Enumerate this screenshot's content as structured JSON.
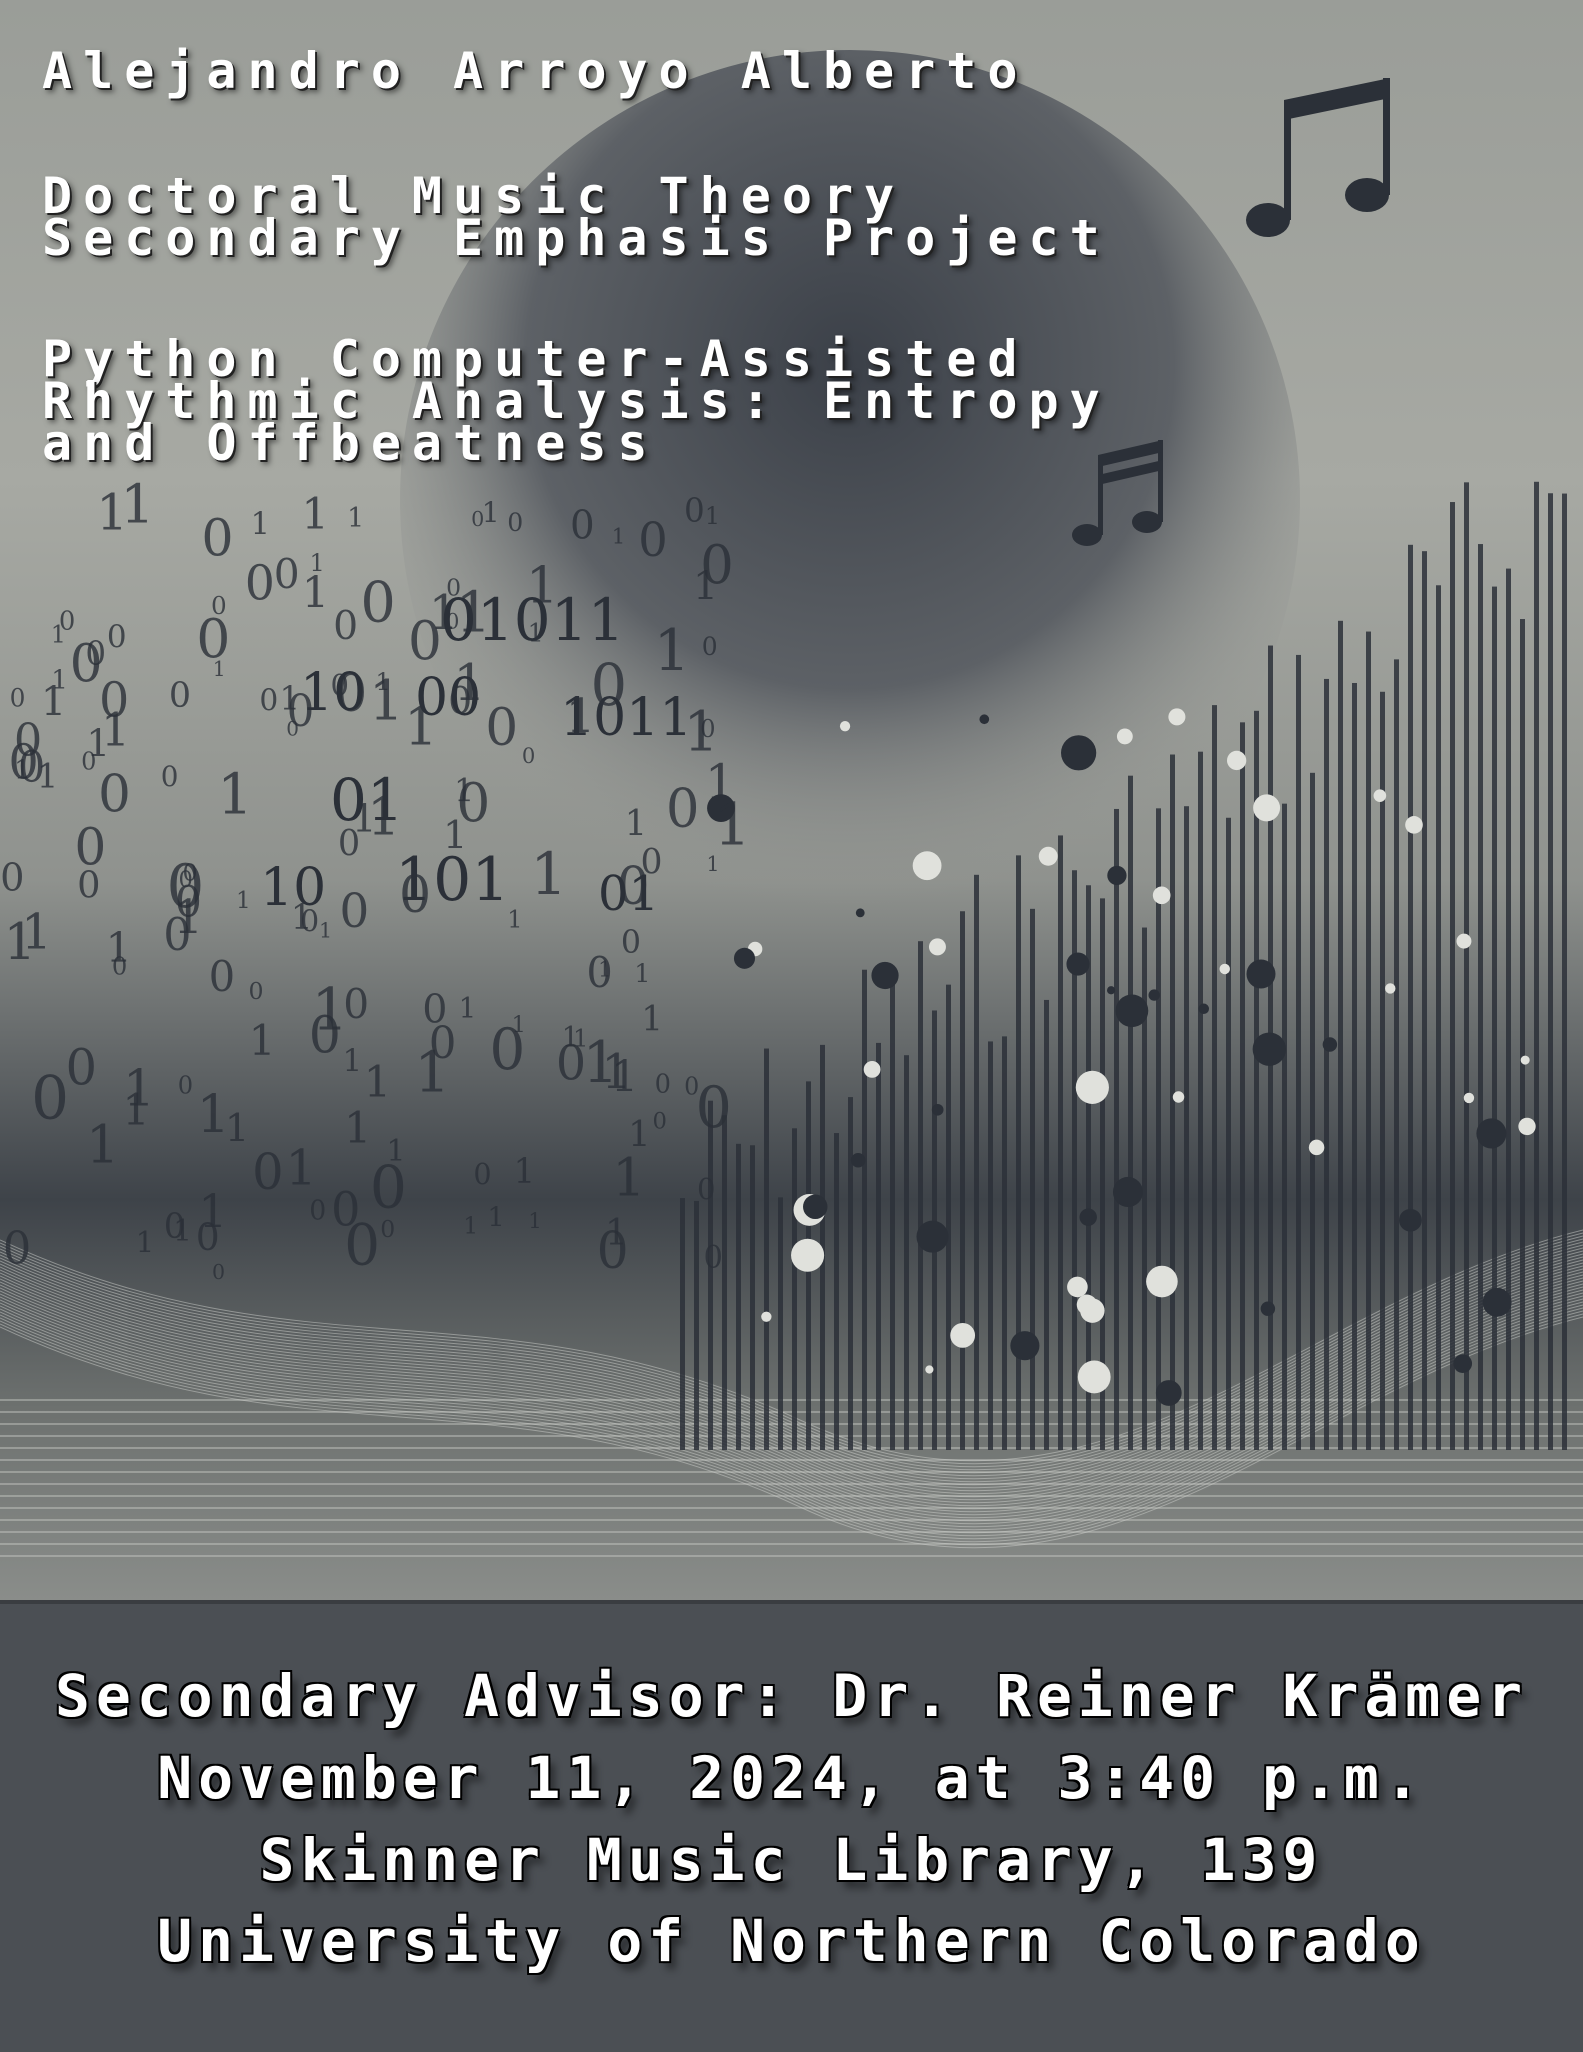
{
  "poster": {
    "presenter": "Alejandro Arroyo Alberto",
    "program_line_1": "Doctoral Music Theory",
    "program_line_2": "Secondary Emphasis Project",
    "title_line_1": "Python Computer-Assisted",
    "title_line_2": "Rhythmic Analysis: Entropy",
    "title_line_3": "and Offbeatness"
  },
  "details": {
    "advisor": "Secondary Advisor: Dr. Reiner Krämer",
    "datetime": "November 11, 2024, at 3:40 p.m.",
    "location": "Skinner Music Library, 139",
    "institution": "University of Northern Colorado"
  },
  "colors": {
    "panel": "#4b4f54",
    "ink": "#2b3038",
    "text": "#ffffff"
  }
}
